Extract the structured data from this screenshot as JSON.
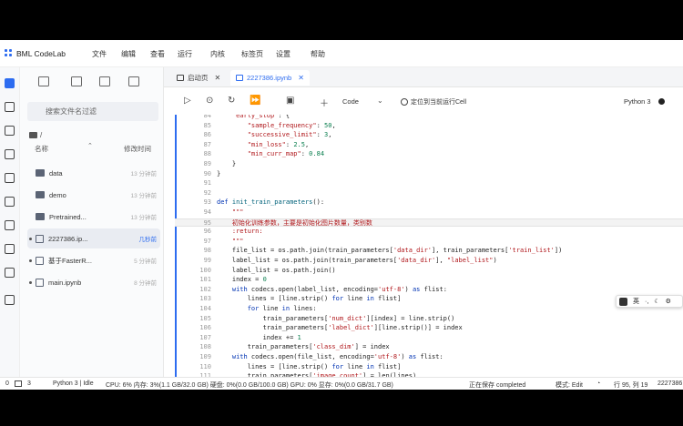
{
  "app": {
    "name": "BML CodeLab",
    "brand_color": "#2d6cf0"
  },
  "menu": [
    "文件",
    "编辑",
    "查看",
    "运行",
    "内核",
    "标签页",
    "设置",
    "帮助"
  ],
  "tabs": [
    {
      "label": "启动页",
      "active": false
    },
    {
      "label": "2227386.ipynb",
      "active": true
    }
  ],
  "file_browser": {
    "search_placeholder": "搜索文件名过滤",
    "breadcrumb": "/",
    "col_name": "名称",
    "col_modified": "修改时间",
    "sort_icon": "caret-up-icon",
    "files": [
      {
        "name": "data",
        "type": "folder",
        "modified": "13 分钟前",
        "selected": false,
        "running": false
      },
      {
        "name": "demo",
        "type": "folder",
        "modified": "13 分钟前",
        "selected": false,
        "running": false
      },
      {
        "name": "Pretrained...",
        "type": "folder",
        "modified": "13 分钟前",
        "selected": false,
        "running": false
      },
      {
        "name": "2227386.ip...",
        "type": "notebook",
        "modified": "几秒前",
        "selected": true,
        "running": true
      },
      {
        "name": "基于FasterR...",
        "type": "notebook",
        "modified": "5 分钟前",
        "selected": false,
        "running": true
      },
      {
        "name": "main.ipynb",
        "type": "notebook",
        "modified": "8 分钟前",
        "selected": false,
        "running": true
      }
    ]
  },
  "notebook_toolbar": {
    "cell_type": "Code",
    "locate_label": "定位到当前运行Cell",
    "kernel_name": "Python 3"
  },
  "code_lines": [
    {
      "n": "84",
      "t": "    \"early_stop\": {"
    },
    {
      "n": "85",
      "t": "        \"sample_frequency\": 50,"
    },
    {
      "n": "86",
      "t": "        \"successive_limit\": 3,"
    },
    {
      "n": "87",
      "t": "        \"min_loss\": 2.5,"
    },
    {
      "n": "88",
      "t": "        \"min_curr_map\": 0.84"
    },
    {
      "n": "89",
      "t": "    }"
    },
    {
      "n": "90",
      "t": "}"
    },
    {
      "n": "91",
      "t": ""
    },
    {
      "n": "92",
      "t": ""
    },
    {
      "n": "93",
      "t": "def init_train_parameters():"
    },
    {
      "n": "94",
      "t": "    \"\"\""
    },
    {
      "n": "95",
      "t": "    初始化训练参数，主要是初始化图片数量，类别数"
    },
    {
      "n": "96",
      "t": "    :return:"
    },
    {
      "n": "97",
      "t": "    \"\"\""
    },
    {
      "n": "98",
      "t": "    file_list = os.path.join(train_parameters['data_dir'], train_parameters['train_list'])"
    },
    {
      "n": "99",
      "t": "    label_list = os.path.join(train_parameters['data_dir'], \"label_list\")"
    },
    {
      "n": "100",
      "t": "    label_list = os.path.join()"
    },
    {
      "n": "101",
      "t": "    index = 0"
    },
    {
      "n": "102",
      "t": "    with codecs.open(label_list, encoding='utf-8') as flist:"
    },
    {
      "n": "103",
      "t": "        lines = [line.strip() for line in flist]"
    },
    {
      "n": "104",
      "t": "        for line in lines:"
    },
    {
      "n": "105",
      "t": "            train_parameters['num_dict'][index] = line.strip()"
    },
    {
      "n": "106",
      "t": "            train_parameters['label_dict'][line.strip()] = index"
    },
    {
      "n": "107",
      "t": "            index += 1"
    },
    {
      "n": "108",
      "t": "        train_parameters['class_dim'] = index"
    },
    {
      "n": "109",
      "t": "    with codecs.open(file_list, encoding='utf-8') as flist:"
    },
    {
      "n": "110",
      "t": "        lines = [line.strip() for line in flist]"
    },
    {
      "n": "111",
      "t": "        train_parameters['image_count'] = len(lines)"
    }
  ],
  "highlighted_line": "95",
  "ime": {
    "lang": "英",
    "punct": "·,",
    "moon": "☾",
    "gear": "⚙"
  },
  "status": {
    "zero": "0",
    "three": "3",
    "kernel": "Python 3 | Idle",
    "resources": "CPU:  6% 内存:  3%(1.1 GB/32.0 GB) 硬盘:  0%(0.0 GB/100.0 GB) GPU:  0%  显存:  0%(0.0 GB/31.7 GB)",
    "save": "正在保存 completed",
    "mode": "模式:  Edit",
    "position": "行 95, 列 19",
    "file": "2227386"
  }
}
